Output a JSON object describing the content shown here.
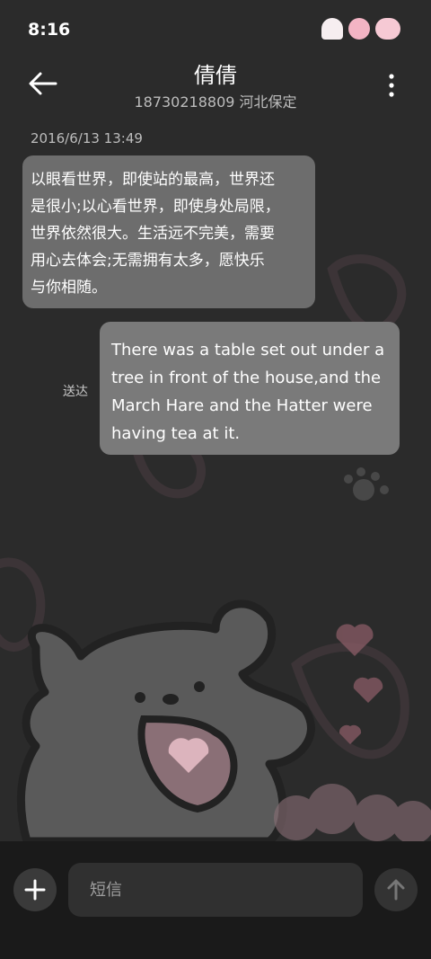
{
  "status_bar": {
    "time": "8:16",
    "icons": [
      "cloud-sticker-icon",
      "flower-sticker-icon",
      "heart-100-sticker-icon"
    ]
  },
  "header": {
    "title": "倩倩",
    "subtitle": "18730218809 河北保定",
    "back_icon": "arrow-left-icon",
    "more_icon": "more-vertical-icon"
  },
  "conversation": {
    "timestamp": "2016/6/13 13:49",
    "messages": [
      {
        "direction": "incoming",
        "lines": [
          "以眼看世界，即使站的最高，世界还",
          "是很小;以心看世界，即使身处局限，",
          "世界依然很大。生活远不完美，需要",
          "用心去体会;无需拥有太多，愿快乐",
          "与你相随。"
        ]
      },
      {
        "direction": "outgoing",
        "status": "送达",
        "lines": [
          "There was a table set out under a",
          "tree in front of the house,and the",
          "March Hare and the Hatter were",
          "having tea at it."
        ]
      }
    ]
  },
  "composer": {
    "placeholder": "短信",
    "add_icon": "plus-icon",
    "send_icon": "arrow-up-icon"
  },
  "colors": {
    "background": "#2b2b2b",
    "incoming_bubble": "#6d6d6d",
    "outgoing_bubble": "#7a7a7a",
    "bottom_bar": "#1a1a1a"
  }
}
